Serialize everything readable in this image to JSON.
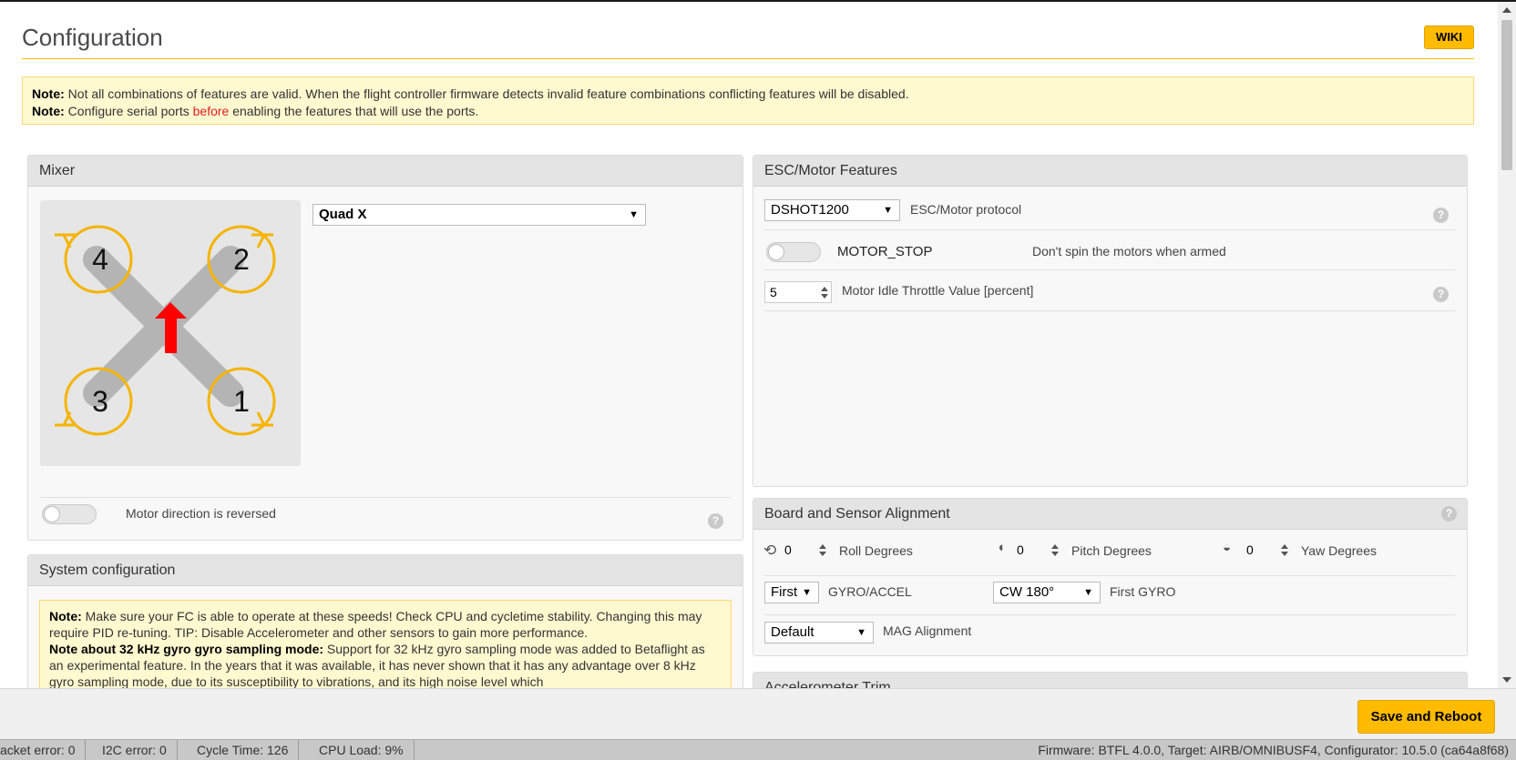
{
  "page": {
    "title": "Configuration",
    "wiki_label": "WIKI"
  },
  "notes": {
    "line1_label": "Note:",
    "line1_text": " Not all combinations of features are valid. When the flight controller firmware detects invalid feature combinations conflicting features will be disabled.",
    "line2_label": "Note:",
    "line2_pre": " Configure serial ports ",
    "line2_red": "before",
    "line2_post": " enabling the features that will use the ports."
  },
  "mixer": {
    "title": "Mixer",
    "selected": "Quad X",
    "motor_labels": [
      "4",
      "2",
      "3",
      "1"
    ],
    "motor_reversed_label": "Motor direction is reversed",
    "motor_reversed": false,
    "help": "?"
  },
  "esc": {
    "title": "ESC/Motor Features",
    "protocol_value": "DSHOT1200",
    "protocol_label": "ESC/Motor protocol",
    "motor_stop_label": "MOTOR_STOP",
    "motor_stop_desc": "Don't spin the motors when armed",
    "motor_stop": false,
    "idle_value": "5",
    "idle_label": "Motor Idle Throttle Value [percent]",
    "help": "?"
  },
  "board": {
    "title": "Board and Sensor Alignment",
    "roll_value": "0",
    "roll_label": "Roll Degrees",
    "pitch_value": "0",
    "pitch_label": "Pitch Degrees",
    "yaw_value": "0",
    "yaw_label": "Yaw Degrees",
    "gyro_select": "First",
    "gyro_label": "GYRO/ACCEL",
    "first_gyro_select": "CW 180°",
    "first_gyro_label": "First GYRO",
    "mag_select": "Default",
    "mag_label": "MAG Alignment",
    "help": "?"
  },
  "accel": {
    "title": "Accelerometer Trim"
  },
  "system": {
    "title": "System configuration",
    "note1_label": "Note:",
    "note1_text": " Make sure your FC is able to operate at these speeds! Check CPU and cycletime stability. Changing this may require PID re-tuning. TIP: Disable Accelerometer and other sensors to gain more performance.",
    "note2_label": "Note about 32 kHz gyro gyro sampling mode:",
    "note2_text": " Support for 32 kHz gyro sampling mode was added to Betaflight as an experimental feature. In the years that it was available, it has never shown that it has any advantage over 8 kHz gyro sampling mode, due to its susceptibility to vibrations, and its high noise level which"
  },
  "footer": {
    "save_label": "Save and Reboot"
  },
  "status": {
    "packet_error": "acket error: 0",
    "i2c_error": "I2C error: 0",
    "cycle_time": "Cycle Time: 126",
    "cpu_load": "CPU Load: 9%",
    "firmware": "Firmware: BTFL 4.0.0, Target: AIRB/OMNIBUSF4, Configurator: 10.5.0 (ca64a8f68)"
  },
  "colors": {
    "accent": "#ffbb00",
    "note_bg": "#fff9d0",
    "arrow_red": "#ff0000",
    "arm_gray": "#b4b4b4"
  }
}
